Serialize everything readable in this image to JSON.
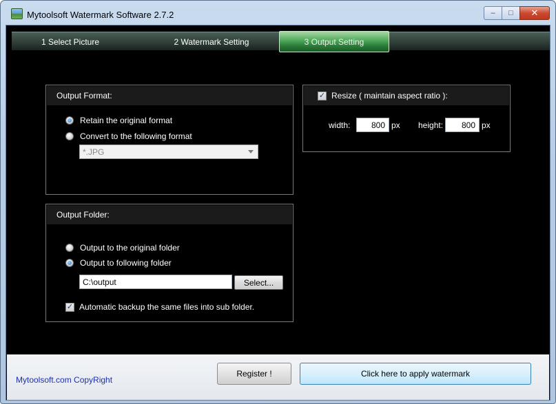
{
  "window": {
    "title": "Mytoolsoft Watermark Software 2.7.2",
    "icon": "app-picture-icon",
    "caption_buttons": {
      "minimize": "–",
      "maximize": "□",
      "close": "✕"
    }
  },
  "tabs": [
    {
      "label": "1 Select Picture",
      "active": false
    },
    {
      "label": "2 Watermark Setting",
      "active": false
    },
    {
      "label": "3 Output Setting",
      "active": true
    }
  ],
  "output_format": {
    "title": "Output Format:",
    "options": [
      {
        "label": "Retain the original format",
        "checked": true
      },
      {
        "label": "Convert to the following format",
        "checked": false
      }
    ],
    "format_select": {
      "value": "*.JPG",
      "disabled": true
    }
  },
  "output_folder": {
    "title": "Output Folder:",
    "options": [
      {
        "label": "Output to the original folder",
        "checked": false
      },
      {
        "label": "Output to following folder",
        "checked": true
      }
    ],
    "folder_path": "C:\\output",
    "select_button": "Select...",
    "backup_checkbox": {
      "label": "Automatic backup the same files into sub folder.",
      "checked": true
    }
  },
  "resize": {
    "label": "Resize ( maintain aspect ratio ):",
    "checked": true,
    "width_label": "width:",
    "width_value": "800",
    "width_unit": "px",
    "height_label": "height:",
    "height_value": "800",
    "height_unit": "px"
  },
  "footer": {
    "copyright": "Mytoolsoft.com CopyRight",
    "register_button": "Register !",
    "apply_button": "Click here to apply watermark"
  },
  "colors": {
    "background": "#000000",
    "active_tab": "#3f9a4d",
    "copyright_text": "#1c2fb0",
    "apply_button": "#d9f0fc"
  }
}
